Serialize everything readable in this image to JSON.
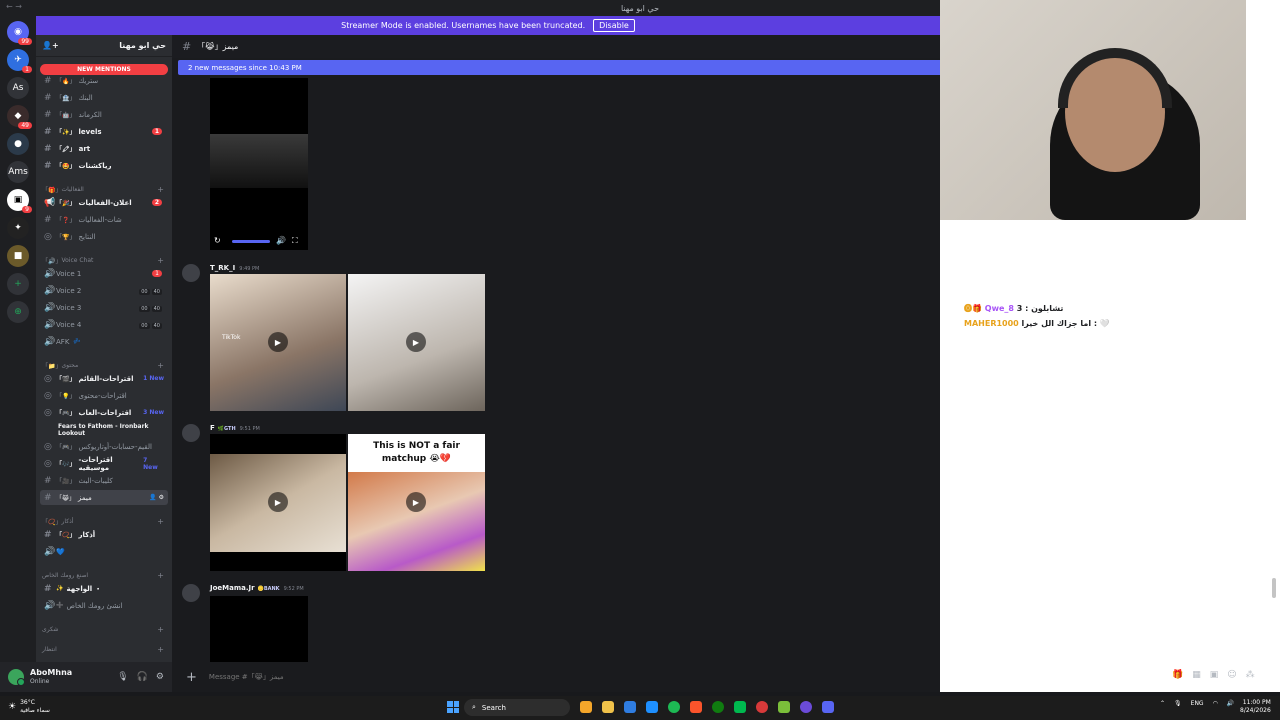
{
  "window": {
    "title": "حي ابو مهنا"
  },
  "streamer": {
    "text": "Streamer Mode is enabled. Usernames have been truncated.",
    "disable_label": "Disable"
  },
  "rail": {
    "items": [
      "As",
      "Ams"
    ]
  },
  "guild": {
    "name": "حي ابو مهنا"
  },
  "sidebar": {
    "new_mentions": "NEW MENTIONS",
    "channels": [
      {
        "label": "ستريك",
        "emoji": "「🔥」"
      },
      {
        "label": "البنك",
        "emoji": "「🏦」"
      },
      {
        "label": "الكرماند",
        "emoji": "「🤖」"
      },
      {
        "label": "levels",
        "emoji": "「✨」",
        "badge": "1"
      },
      {
        "label": "art",
        "emoji": "「🖍」"
      },
      {
        "label": "رياكشنات",
        "emoji": "「🤩」"
      }
    ],
    "cat_events": "الفعاليات",
    "event_channels": [
      {
        "label": "اعلان-الفعاليات",
        "emoji": "「🎉」",
        "badge": "2"
      },
      {
        "label": "شات-الفعاليات",
        "emoji": "「❓」"
      },
      {
        "label": "النتايج",
        "emoji": "「🏆」"
      }
    ],
    "cat_voice": "Voice Chat",
    "voice": [
      {
        "label": "Voice 1",
        "badge": "1"
      },
      {
        "label": "Voice 2",
        "c1": "00",
        "c2": "40"
      },
      {
        "label": "Voice 3",
        "c1": "00",
        "c2": "40"
      },
      {
        "label": "Voice 4",
        "c1": "00",
        "c2": "40"
      },
      {
        "label": "AFK"
      }
    ],
    "cat_content": "محتوى",
    "content": [
      {
        "label": "اقتراحات-القائم",
        "emoji": "「🎬」",
        "tag": "1 New"
      },
      {
        "label": "اقتراحات-محتوى",
        "emoji": "「💡」"
      },
      {
        "label": "اقتراحات-العاب",
        "emoji": "「🎮」",
        "tag": "3 New"
      },
      {
        "label": "Fears to Fathom - Ironbark Lookout",
        "thread": true
      },
      {
        "label": "القيم-حسابات-أوتاريوكس",
        "emoji": "「🎮」"
      },
      {
        "label": "اقتراحات-موسيقيه",
        "emoji": "「🎶」",
        "tag": "7 New"
      },
      {
        "label": "كليبات-البث",
        "emoji": "「🎥」"
      },
      {
        "label": "ميمز",
        "emoji": "「😹」",
        "active": true
      }
    ],
    "cat_azkar": "أذكار",
    "azkar": [
      {
        "label": "أذكار",
        "emoji": "「📿」"
      }
    ],
    "cat_room": "اصنع رومك الخاص",
    "room": [
      {
        "label": "الواجهة ・",
        "emoji": "✨"
      },
      {
        "label": "انشئ رومك الخاص",
        "emoji": "➕"
      }
    ],
    "cat_thanks": "شكرى",
    "cat_wait": "انتظار"
  },
  "user": {
    "name": "AboMhna",
    "status": "Online"
  },
  "chat": {
    "channel_name": "「😹」ميمز",
    "new_messages": "2 new messages since 10:43 PM",
    "messages": [
      {
        "author": "T_RK_I",
        "time": "9:49 PM",
        "tag": ""
      },
      {
        "author": "F",
        "time": "9:51 PM",
        "tag": "🌿GTH"
      },
      {
        "author": "JoeMama.Jr",
        "time": "9:52 PM",
        "tag": "🪙BANK"
      }
    ],
    "video_caption": "This is NOT a fair matchup 😭💔",
    "tiktok": "TikTok",
    "placeholder": "Message #「😹」ميمز"
  },
  "stream_chat": [
    {
      "user": "Qwe_8",
      "text": "تشابلون : 3"
    },
    {
      "user": "MAHER1000",
      "text": "اما جزاك الل خيرا : 🤍"
    }
  ],
  "taskbar": {
    "temp": "36°C",
    "weather": "سماء صافية",
    "search": "Search",
    "lang": "ENG",
    "time": "11:00 PM",
    "date": "8/24/2026"
  },
  "colors": {
    "accent": "#5865f2",
    "streamer": "#5c3fe0",
    "red": "#f23f43"
  }
}
